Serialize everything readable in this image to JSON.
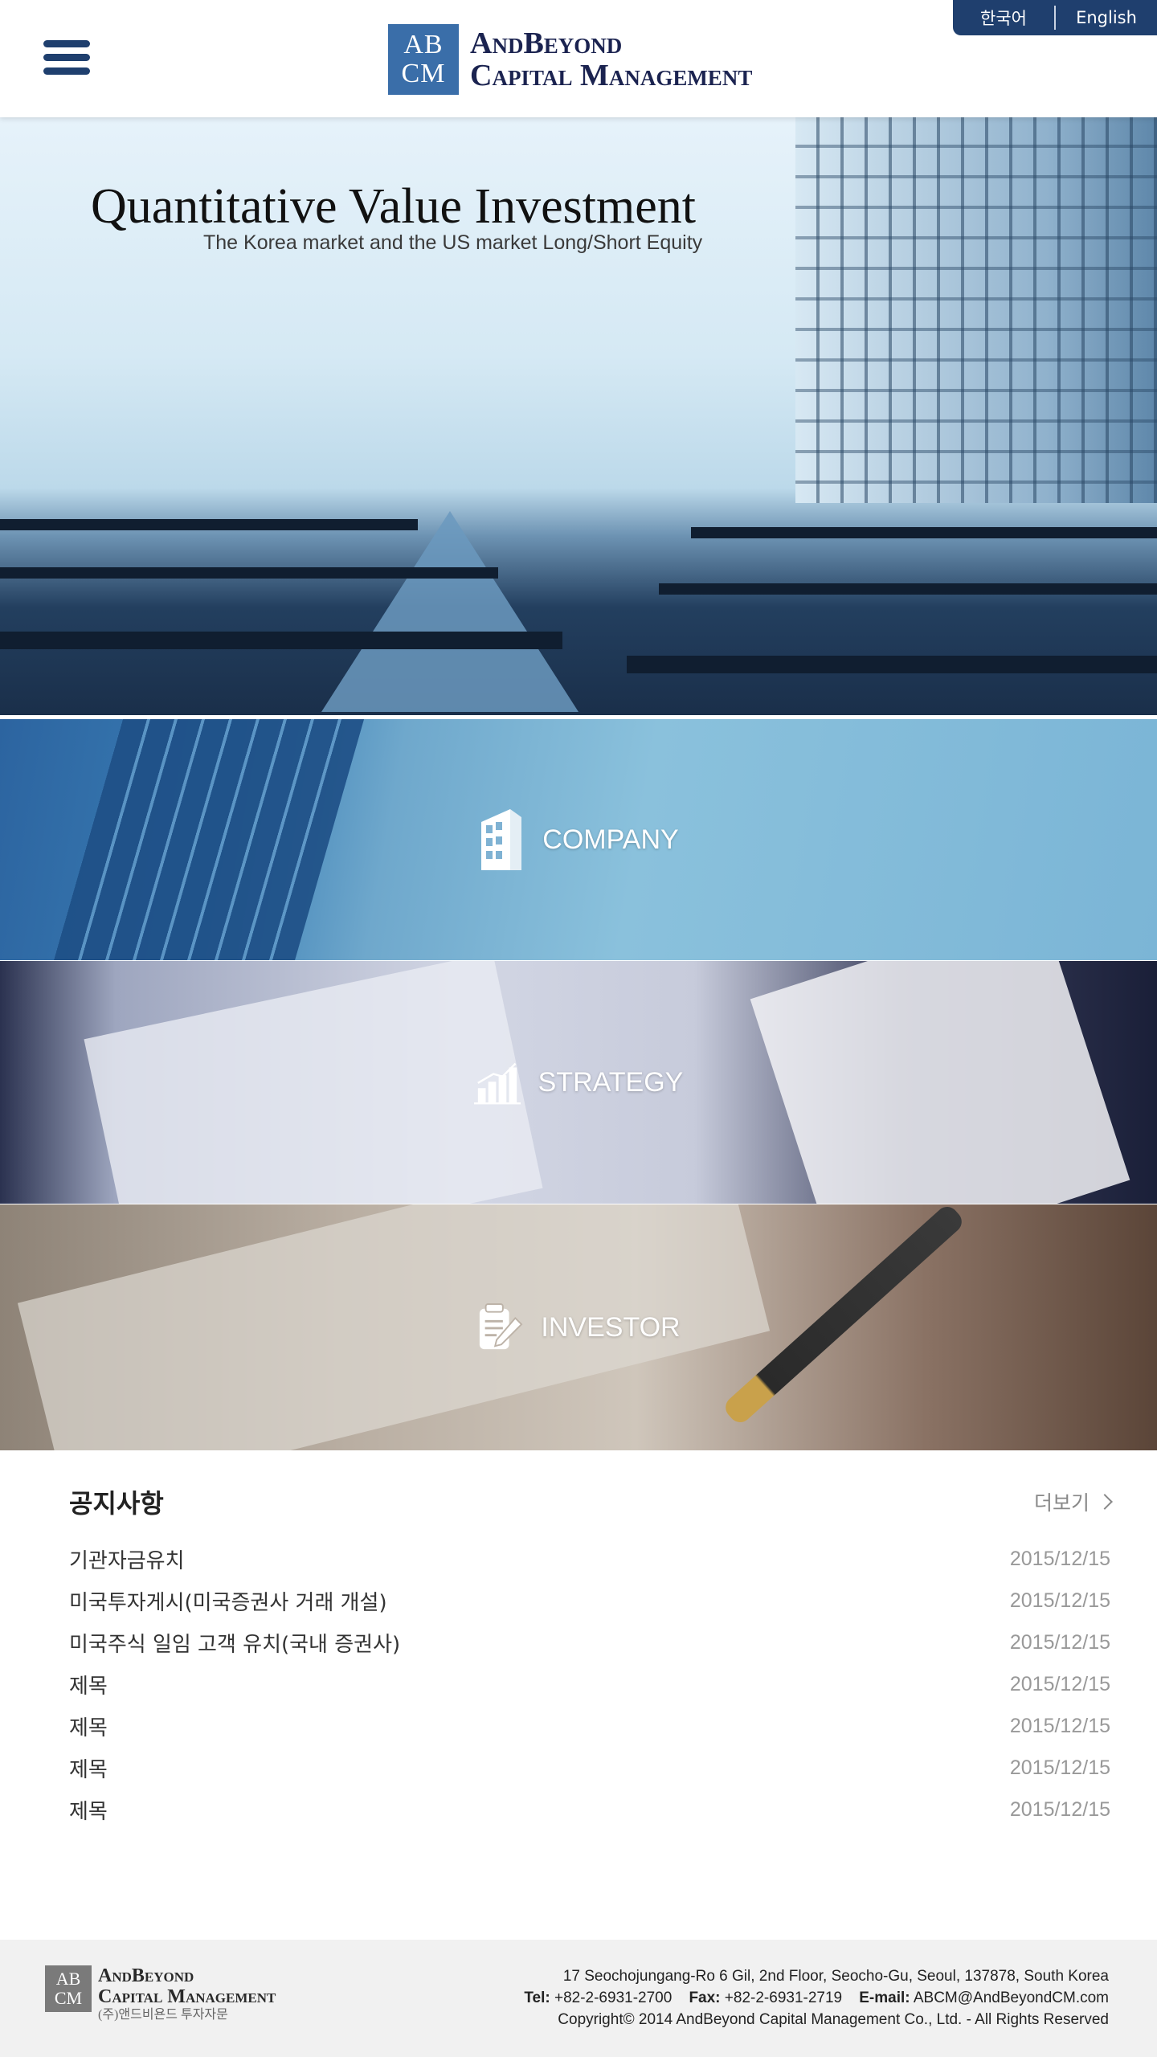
{
  "header": {
    "logo_mark_line1": "AB",
    "logo_mark_line2": "CM",
    "logo_name_line1": "AndBeyond",
    "logo_name_line2": "Capital Management",
    "languages": [
      "한국어",
      "English"
    ]
  },
  "hero": {
    "title": "Quantitative Value Investment",
    "subtitle": "The Korea market and the US market Long/Short Equity"
  },
  "panels": [
    {
      "label": "COMPANY",
      "icon": "building-icon"
    },
    {
      "label": "STRATEGY",
      "icon": "bar-chart-icon"
    },
    {
      "label": "INVESTOR",
      "icon": "document-pen-icon"
    }
  ],
  "notices": {
    "title": "공지사항",
    "more_label": "더보기",
    "items": [
      {
        "title": "기관자금유치",
        "date": "2015/12/15"
      },
      {
        "title": "미국투자게시(미국증권사 거래 개설)",
        "date": "2015/12/15"
      },
      {
        "title": "미국주식 일임 고객 유치(국내 증권사)",
        "date": "2015/12/15"
      },
      {
        "title": "제목",
        "date": "2015/12/15"
      },
      {
        "title": "제목",
        "date": "2015/12/15"
      },
      {
        "title": "제목",
        "date": "2015/12/15"
      },
      {
        "title": "제목",
        "date": "2015/12/15"
      }
    ]
  },
  "footer": {
    "logo_mark_line1": "AB",
    "logo_mark_line2": "CM",
    "logo_name_line1": "AndBeyond",
    "logo_name_line2": "Capital Management",
    "logo_korean": "(주)앤드비욘드 투자자문",
    "address": "17 Seochojungang-Ro 6 Gil, 2nd Floor, Seocho-Gu, Seoul, 137878, South Korea",
    "tel_label": "Tel:",
    "tel": "+82-2-6931-2700",
    "fax_label": "Fax:",
    "fax": "+82-2-6931-2719",
    "email_label": "E-mail:",
    "email": "ABCM@AndBeyondCM.com",
    "copyright": "Copyright© 2014 AndBeyond Capital Management Co., Ltd. - All Rights Reserved"
  },
  "colors": {
    "brand_navy": "#1f3f6e",
    "logo_blue": "#3a6ea9"
  }
}
